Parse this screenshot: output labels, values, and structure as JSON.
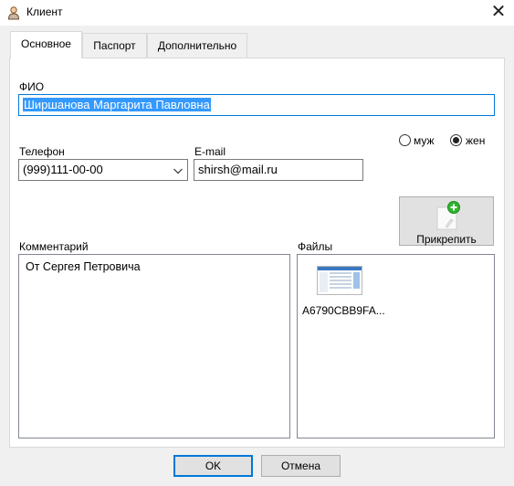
{
  "window": {
    "title": "Клиент",
    "close_glyph": "✕"
  },
  "tabs": [
    {
      "label": "Основное",
      "active": true
    },
    {
      "label": "Паспорт",
      "active": false
    },
    {
      "label": "Дополнительно",
      "active": false
    }
  ],
  "form": {
    "fio_label": "ФИО",
    "fio_value": "Ширшанова Маргарита Павловна",
    "phone_label": "Телефон",
    "phone_value": "(999)111-00-00",
    "email_label": "E-mail",
    "email_value": "shirsh@mail.ru",
    "gender": {
      "male_label": "муж",
      "female_label": "жен",
      "selected": "жен"
    },
    "attach_button_label": "Прикрепить",
    "comment_label": "Комментарий",
    "comment_value": "От Сергея Петровича",
    "files_label": "Файлы",
    "files": [
      {
        "name": "A6790CBB9FA..."
      }
    ]
  },
  "buttons": {
    "ok_label": "OK",
    "cancel_label": "Отмена"
  },
  "colors": {
    "selection": "#3399ff",
    "focus_border": "#0078d7",
    "attach_plus": "#2fb52f"
  }
}
